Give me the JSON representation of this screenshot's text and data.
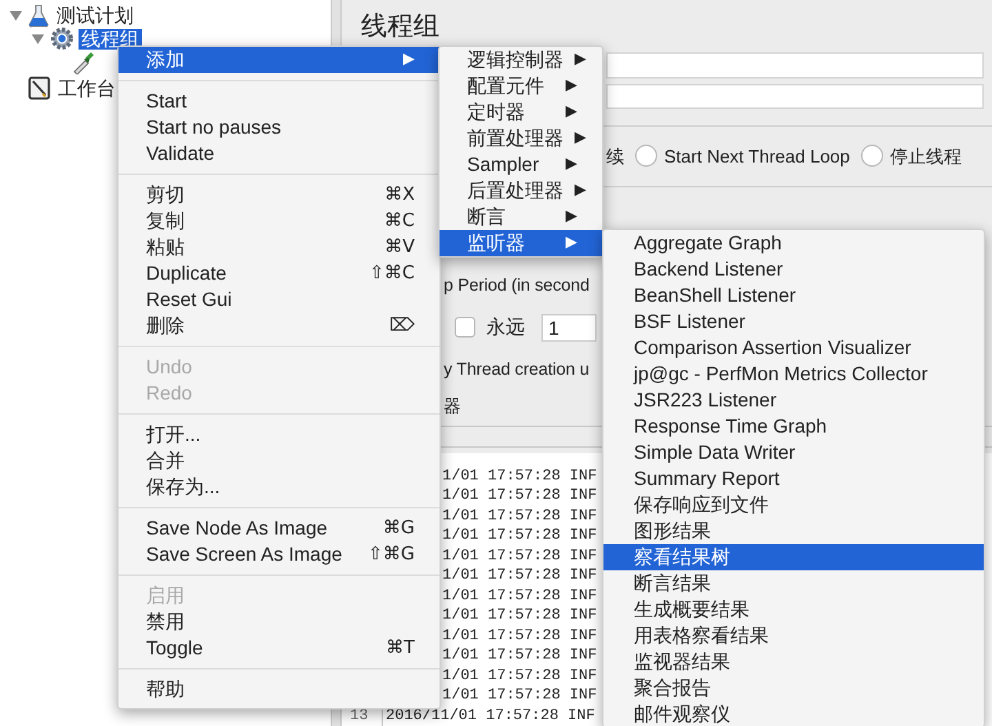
{
  "tree": [
    {
      "kind": "test-plan",
      "label": "测试计划",
      "expanded": true,
      "selected": false,
      "children": [
        {
          "kind": "thread-group",
          "label": "线程组",
          "expanded": true,
          "selected": true,
          "children": [
            {
              "kind": "element"
            }
          ]
        }
      ]
    },
    {
      "kind": "workbench",
      "label": "工作台",
      "selected": false
    }
  ],
  "panel": {
    "title": "线程组",
    "action_fragment": "续",
    "radios": [
      {
        "label": "Start Next Thread Loop",
        "selected": false
      },
      {
        "label": "停止线程",
        "selected": false
      }
    ],
    "ramp_label": "p Period (in second",
    "loop_forever": {
      "label": "永远",
      "checked": false
    },
    "loop_count": "1",
    "delay_label": "y Thread creation u",
    "scheduler_label": "器",
    "log_lines": [
      {
        "text": "1/01 17:57:28 INF"
      },
      {
        "text": "1/01 17:57:28 INF"
      },
      {
        "text": "1/01 17:57:28 INF"
      },
      {
        "text": "1/01 17:57:28 INF"
      },
      {
        "text": "1/01 17:57:28 INF"
      },
      {
        "text": "1/01 17:57:28 INF"
      },
      {
        "text": "1/01 17:57:28 INF"
      },
      {
        "text": "1/01 17:57:28 INF"
      },
      {
        "text": "1/01 17:57:28 INF"
      },
      {
        "text": "1/01 17:57:28 INF"
      },
      {
        "text": "1/01 17:57:28 INF"
      },
      {
        "text": "1/01 17:57:28 INF"
      },
      {
        "number": "13",
        "text": "2016/11/01 17:57:28 INF"
      }
    ]
  },
  "context_menu": {
    "items": [
      {
        "kind": "item",
        "label": "添加",
        "arrow": "▶",
        "selected": true,
        "disabled": false
      },
      {
        "kind": "separator"
      },
      {
        "kind": "item",
        "label": "Start",
        "selected": false,
        "disabled": false
      },
      {
        "kind": "item",
        "label": "Start no pauses",
        "selected": false,
        "disabled": false
      },
      {
        "kind": "item",
        "label": "Validate",
        "selected": false,
        "disabled": false
      },
      {
        "kind": "separator"
      },
      {
        "kind": "item",
        "label": "剪切",
        "shortcut": "⌘X",
        "selected": false,
        "disabled": false
      },
      {
        "kind": "item",
        "label": "复制",
        "shortcut": "⌘C",
        "selected": false,
        "disabled": false
      },
      {
        "kind": "item",
        "label": "粘贴",
        "shortcut": "⌘V",
        "selected": false,
        "disabled": false
      },
      {
        "kind": "item",
        "label": "Duplicate",
        "shortcut": "⇧⌘C",
        "selected": false,
        "disabled": false
      },
      {
        "kind": "item",
        "label": "Reset Gui",
        "selected": false,
        "disabled": false
      },
      {
        "kind": "item",
        "label": "删除",
        "shortcut": "⌦",
        "selected": false,
        "disabled": false
      },
      {
        "kind": "separator"
      },
      {
        "kind": "item",
        "label": "Undo",
        "selected": false,
        "disabled": true
      },
      {
        "kind": "item",
        "label": "Redo",
        "selected": false,
        "disabled": true
      },
      {
        "kind": "separator"
      },
      {
        "kind": "item",
        "label": "打开...",
        "selected": false,
        "disabled": false
      },
      {
        "kind": "item",
        "label": "合并",
        "selected": false,
        "disabled": false
      },
      {
        "kind": "item",
        "label": "保存为...",
        "selected": false,
        "disabled": false
      },
      {
        "kind": "separator"
      },
      {
        "kind": "item",
        "label": "Save Node As Image",
        "shortcut": "⌘G",
        "selected": false,
        "disabled": false
      },
      {
        "kind": "item",
        "label": "Save Screen As Image",
        "shortcut": "⇧⌘G",
        "selected": false,
        "disabled": false
      },
      {
        "kind": "separator"
      },
      {
        "kind": "item",
        "label": "启用",
        "selected": false,
        "disabled": true
      },
      {
        "kind": "item",
        "label": "禁用",
        "selected": false,
        "disabled": false
      },
      {
        "kind": "item",
        "label": "Toggle",
        "shortcut": "⌘T",
        "selected": false,
        "disabled": false
      },
      {
        "kind": "separator"
      },
      {
        "kind": "item",
        "label": "帮助",
        "selected": false,
        "disabled": false
      }
    ]
  },
  "add_submenu": {
    "items": [
      {
        "label": "逻辑控制器",
        "arrow": "▶",
        "selected": false
      },
      {
        "label": "配置元件",
        "arrow": "▶",
        "selected": false
      },
      {
        "label": "定时器",
        "arrow": "▶",
        "selected": false
      },
      {
        "label": "前置处理器",
        "arrow": "▶",
        "selected": false
      },
      {
        "label": "Sampler",
        "arrow": "▶",
        "selected": false
      },
      {
        "label": "后置处理器",
        "arrow": "▶",
        "selected": false
      },
      {
        "label": "断言",
        "arrow": "▶",
        "selected": false
      },
      {
        "label": "监听器",
        "arrow": "▶",
        "selected": true
      }
    ]
  },
  "listener_submenu": {
    "items": [
      {
        "label": "Aggregate Graph",
        "selected": false
      },
      {
        "label": "Backend Listener",
        "selected": false
      },
      {
        "label": "BeanShell Listener",
        "selected": false
      },
      {
        "label": "BSF Listener",
        "selected": false
      },
      {
        "label": "Comparison Assertion Visualizer",
        "selected": false
      },
      {
        "label": "jp@gc - PerfMon Metrics Collector",
        "selected": false
      },
      {
        "label": "JSR223 Listener",
        "selected": false
      },
      {
        "label": "Response Time Graph",
        "selected": false
      },
      {
        "label": "Simple Data Writer",
        "selected": false
      },
      {
        "label": "Summary Report",
        "selected": false
      },
      {
        "label": "保存响应到文件",
        "selected": false
      },
      {
        "label": "图形结果",
        "selected": false
      },
      {
        "label": "察看结果树",
        "selected": true
      },
      {
        "label": "断言结果",
        "selected": false
      },
      {
        "label": "生成概要结果",
        "selected": false
      },
      {
        "label": "用表格察看结果",
        "selected": false
      },
      {
        "label": "监视器结果",
        "selected": false
      },
      {
        "label": "聚合报告",
        "selected": false
      },
      {
        "label": "邮件观察仪",
        "selected": false
      }
    ]
  }
}
